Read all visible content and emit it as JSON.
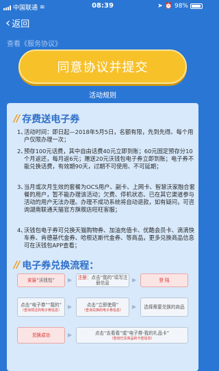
{
  "status": {
    "carrier": "中国联通",
    "time": "08:39",
    "battery_pct": "98%",
    "battery_level": 0.98
  },
  "nav": {
    "back_label": "返回"
  },
  "agreement_line": "查看《服务协议》",
  "agree_button": "同意协议并提交",
  "rules_title": "活动规则",
  "section1_title": "存费送电子券",
  "rules": [
    {
      "num": "1、",
      "text": "活动时间：即日起—2018年5月5日，名额有限，先到先得。每个用户仅限办理一次；"
    },
    {
      "num": "2、",
      "text": "预存100元话费，其中自由话费40元立即到账；60元固定预存分10个月返还，每月返6元；赠送20元沃钱包电子券立即到账；电子券不能兑换话费，有效期90天，过期不可使用、不可延期；"
    },
    {
      "num": "3、",
      "text": "当月或次月生效的套餐为OCS用户、副卡、上网卡、智慧沃家融合套餐的用户，暂不能办理该活动；欠费、停机状态、已在其它渠道参与活动的用户无法办理。办理不成功系统将自动退款，如有疑问，可咨询湖南联通天猫官方旗舰店旺旺客服；"
    },
    {
      "num": "4、",
      "text": "沃钱包电子券可兑换天猫购物券、加油充值卡、优酷会员卡、滴滴快车券、肯德基代金券、哈根达斯代金券、等商品，更多兑换商品信息可在沃钱包APP查看；"
    }
  ],
  "section2_title": "电子券兑换流程：",
  "flow": {
    "row1": [
      {
        "pre": "安装",
        "main": "“沃钱包”"
      },
      {
        "pre": "注册",
        "main": "：点击“我的”填写注册信息"
      },
      {
        "main": "登 陆"
      }
    ],
    "row2": [
      {
        "main": "点击“电子券”“我的”",
        "hint": "（查询领过的电子券信息）"
      },
      {
        "main": "点击“立即使用”",
        "hint": "（查询兑换的电子券信息）"
      },
      {
        "main": "选择需要兑换的商品"
      }
    ],
    "row3": [
      {
        "main": "兑换成功"
      },
      {
        "main": "点击“去看看”或“电子券-我的礼品卡”",
        "hint": "（查询已兑商品的卡密信息）"
      }
    ]
  },
  "colors": {
    "background": "#2a76d4",
    "button": "#f7c12a",
    "card": "#d8e9fb",
    "accent_blue": "#2f6fc9",
    "accent_red": "#d9302c"
  }
}
